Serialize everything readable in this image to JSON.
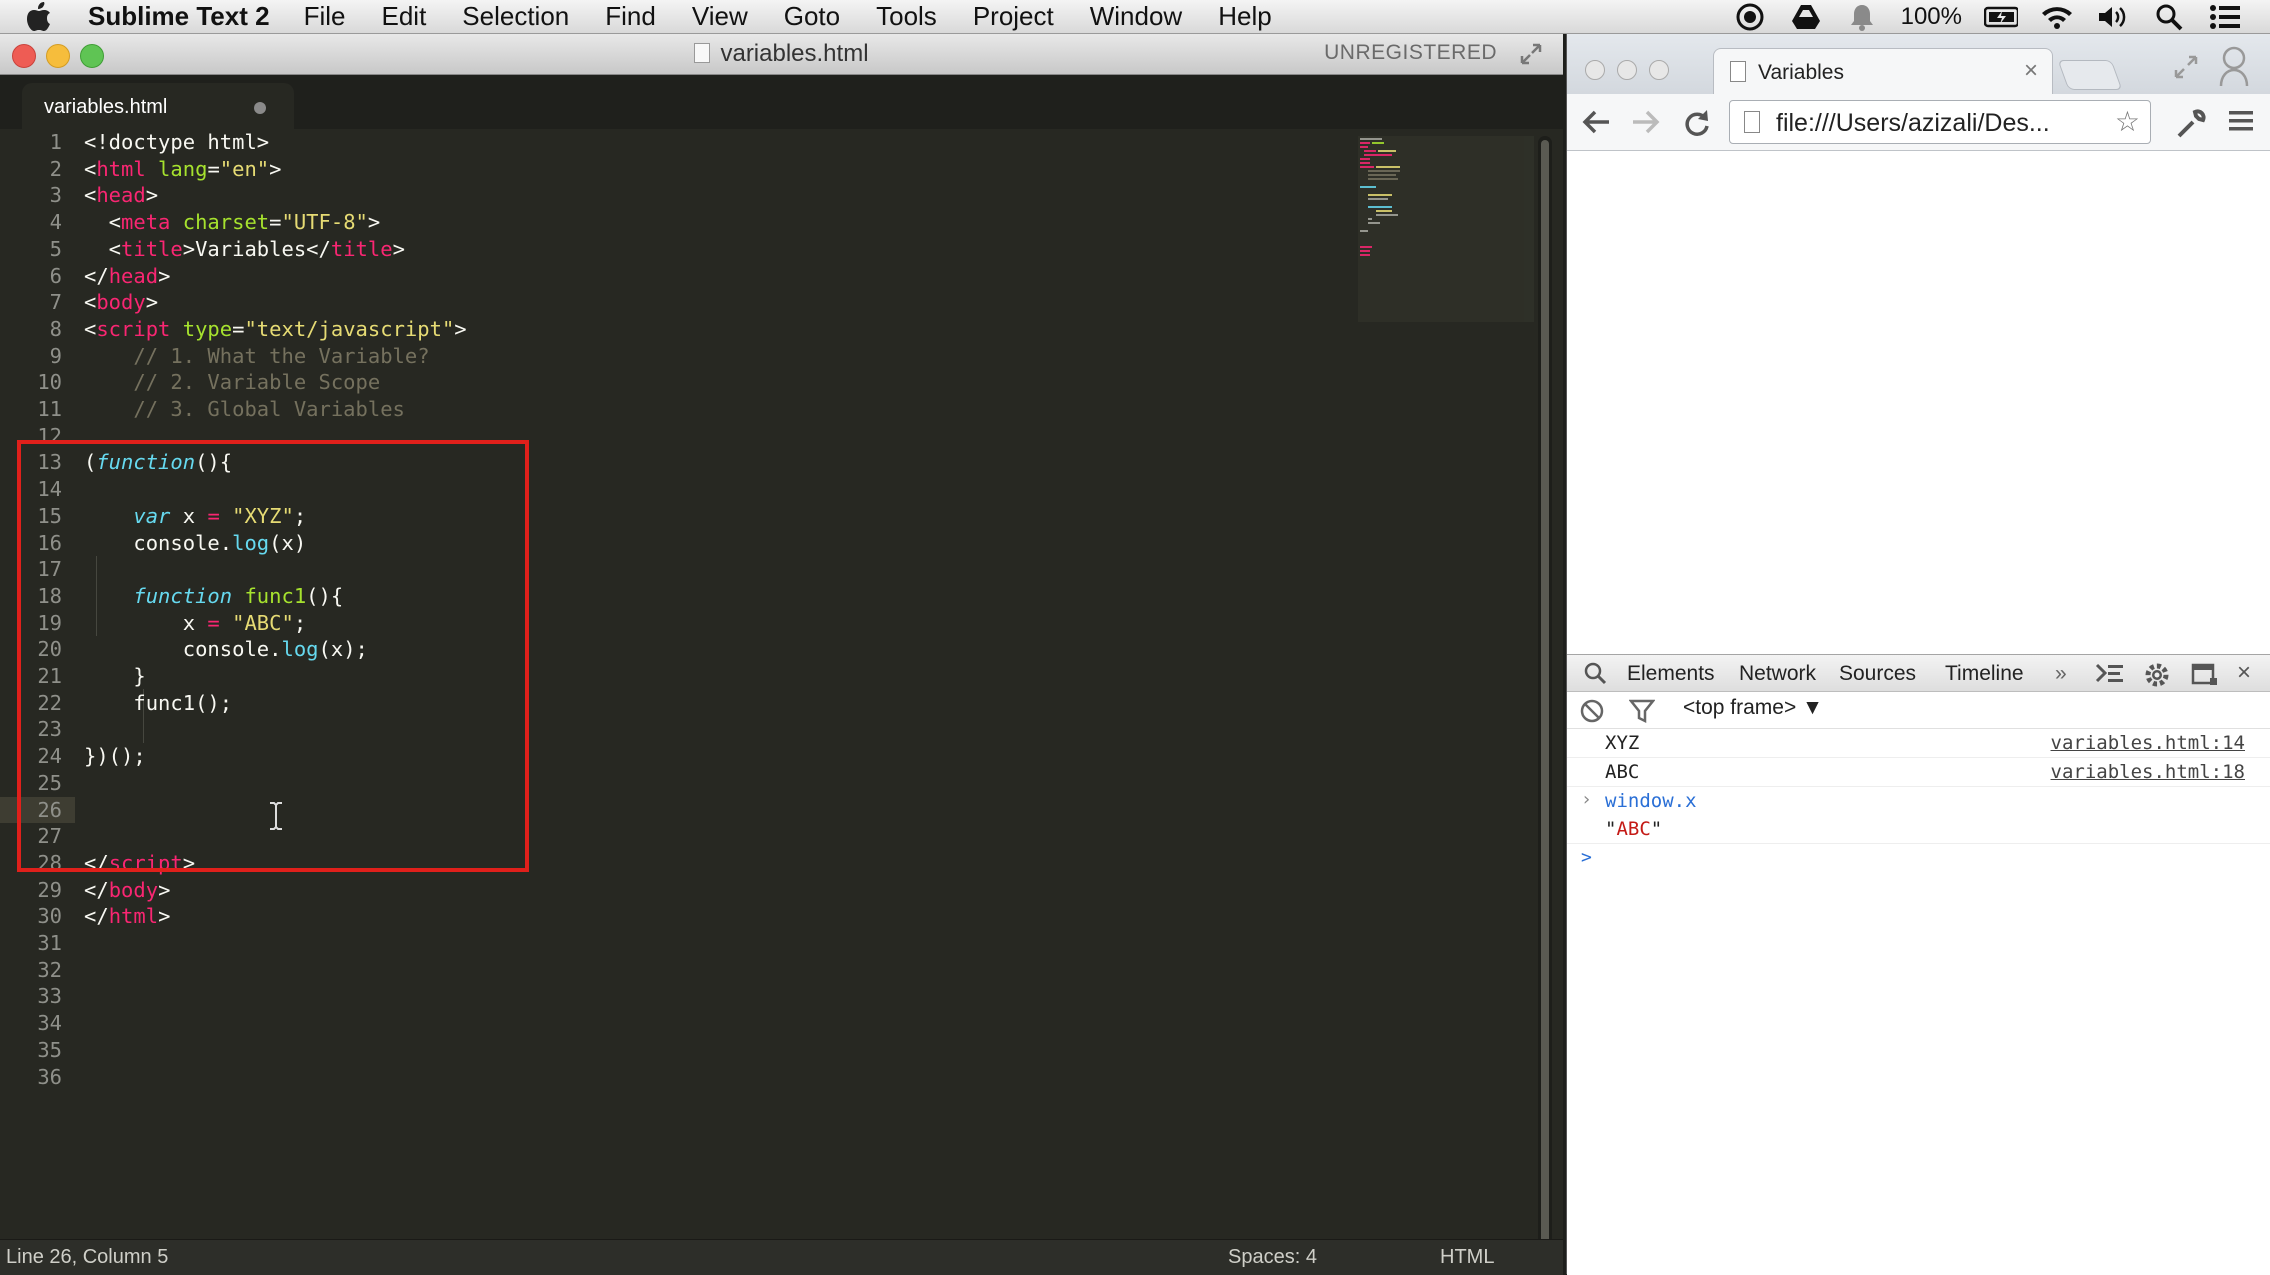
{
  "menubar": {
    "app_name": "Sublime Text 2",
    "menus": [
      "File",
      "Edit",
      "Selection",
      "Find",
      "View",
      "Goto",
      "Tools",
      "Project",
      "Window",
      "Help"
    ],
    "battery": "100%"
  },
  "sublime": {
    "window_title": "variables.html",
    "unregistered": "UNREGISTERED",
    "tab_label": "variables.html",
    "lines": [
      "1",
      "2",
      "3",
      "4",
      "5",
      "6",
      "7",
      "8",
      "9",
      "10",
      "11",
      "12",
      "13",
      "14",
      "15",
      "16",
      "17",
      "18",
      "19",
      "20",
      "21",
      "22",
      "23",
      "24",
      "25",
      "26",
      "27",
      "28",
      "29",
      "30",
      "31",
      "32",
      "33",
      "34",
      "35",
      "36"
    ],
    "code": {
      "l1": "<!doctype html>",
      "l2_open": "<",
      "l2_tag": "html",
      "l2_attr": " lang",
      "l2_eq": "=",
      "l2_val": "\"en\"",
      "l2_close": ">",
      "l3_open": "<",
      "l3_tag": "head",
      "l3_close": ">",
      "l4_open": "  <",
      "l4_tag": "meta",
      "l4_attr": " charset",
      "l4_eq": "=",
      "l4_val": "\"UTF-8\"",
      "l4_close": ">",
      "l5_open": "  <",
      "l5_tag": "title",
      "l5_mid": ">Variables</",
      "l5_tag2": "title",
      "l5_close": ">",
      "l6_open": "</",
      "l6_tag": "head",
      "l6_close": ">",
      "l7_open": "<",
      "l7_tag": "body",
      "l7_close": ">",
      "l8_open": "<",
      "l8_tag": "script",
      "l8_attr": " type",
      "l8_eq": "=",
      "l8_val": "\"text/javascript\"",
      "l8_close": ">",
      "l9": "    // 1. What the Variable?",
      "l10": "    // 2. Variable Scope",
      "l11": "    // 3. Global Variables",
      "l13_a": "(",
      "l13_kw": "function",
      "l13_b": "(){",
      "l15_kw": "    var",
      "l15_a": " x ",
      "l15_op": "=",
      "l15_sp": " ",
      "l15_str": "\"XYZ\"",
      "l15_end": ";",
      "l16_a": "    console.",
      "l16_fn": "log",
      "l16_b": "(x)",
      "l18_kw": "    function",
      "l18_sp": " ",
      "l18_name": "func1",
      "l18_b": "(){",
      "l19_a": "        x ",
      "l19_op": "=",
      "l19_sp": " ",
      "l19_str": "\"ABC\"",
      "l19_end": ";",
      "l20_a": "        console.",
      "l20_fn": "log",
      "l20_b": "(x);",
      "l21": "    }",
      "l22": "    func1();",
      "l24": "})();",
      "l28_open": "</",
      "l28_tag": "script",
      "l28_close": ">",
      "l29_open": "</",
      "l29_tag": "body",
      "l29_close": ">",
      "l30_open": "</",
      "l30_tag": "html",
      "l30_close": ">"
    },
    "status_left": "Line 26, Column 5",
    "status_spaces": "Spaces: 4",
    "status_syntax": "HTML"
  },
  "chrome": {
    "tab_title": "Variables",
    "url": "file:///Users/azizali/Des...",
    "devtools": {
      "tabs": [
        "Elements",
        "Network",
        "Sources",
        "Timeline"
      ],
      "more": "»",
      "frame_label": "<top frame> ▼",
      "console": [
        {
          "msg": "XYZ",
          "src": "variables.html:14"
        },
        {
          "msg": "ABC",
          "src": "variables.html:18"
        }
      ],
      "input": "window.x",
      "result_quote_open": "\"",
      "result_value": "ABC",
      "result_quote_close": "\"",
      "prompt": ">"
    }
  },
  "colors": {
    "highlight_box": "#e0201b",
    "editor_bg": "#272822",
    "tag_pink": "#f92672",
    "attr_green": "#a6e22e",
    "string_yellow": "#e6db74",
    "comment_gray": "#75715e",
    "keyword_blue": "#66d9ef"
  },
  "icons": [
    "apple-icon",
    "record-icon",
    "drive-icon",
    "notification-icon",
    "battery-icon",
    "wifi-icon",
    "volume-icon",
    "spotlight-icon",
    "notification-list-icon",
    "back-icon",
    "forward-icon",
    "reload-icon",
    "star-icon",
    "wrench-icon",
    "menu-icon",
    "search-icon",
    "console-icon",
    "gear-icon",
    "dock-icon",
    "close-icon",
    "clear-icon",
    "filter-icon",
    "text-cursor-icon"
  ]
}
